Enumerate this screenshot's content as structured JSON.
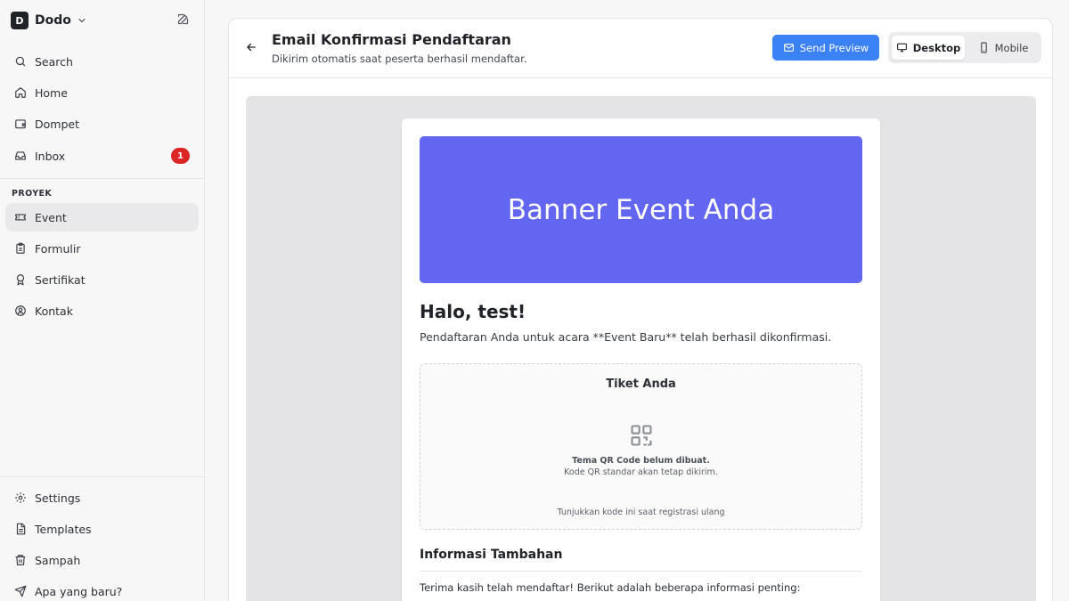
{
  "workspace": {
    "initial": "D",
    "name": "Dodo"
  },
  "sidebar": {
    "top_items": [
      {
        "label": "Search",
        "icon": "search-icon"
      },
      {
        "label": "Home",
        "icon": "home-icon"
      },
      {
        "label": "Dompet",
        "icon": "wallet-icon"
      },
      {
        "label": "Inbox",
        "icon": "inbox-icon",
        "badge": "1"
      }
    ],
    "section_label": "PROYEK",
    "project_items": [
      {
        "label": "Event",
        "icon": "ticket-icon",
        "active": true
      },
      {
        "label": "Formulir",
        "icon": "clipboard-icon"
      },
      {
        "label": "Sertifikat",
        "icon": "award-icon"
      },
      {
        "label": "Kontak",
        "icon": "user-circle-icon"
      }
    ],
    "bottom_items": [
      {
        "label": "Settings",
        "icon": "gear-icon"
      },
      {
        "label": "Templates",
        "icon": "file-icon"
      },
      {
        "label": "Sampah",
        "icon": "trash-icon"
      },
      {
        "label": "Apa yang baru?",
        "icon": "send-icon"
      }
    ]
  },
  "header": {
    "title": "Email Konfirmasi Pendaftaran",
    "subtitle": "Dikirim otomatis saat peserta berhasil mendaftar.",
    "send_label": "Send Preview",
    "view_desktop": "Desktop",
    "view_mobile": "Mobile",
    "active_view": "Desktop"
  },
  "email": {
    "banner_text": "Banner Event Anda",
    "greeting": "Halo, test!",
    "intro": "Pendaftaran Anda untuk acara **Event Baru** telah berhasil dikonfirmasi.",
    "ticket_title": "Tiket Anda",
    "qr_notice_bold": "Tema QR Code belum dibuat.",
    "qr_notice": "Kode QR standar akan tetap dikirim.",
    "ticket_footer": "Tunjukkan kode ini saat registrasi ulang",
    "info_title": "Informasi Tambahan",
    "info_text": "Terima kasih telah mendaftar! Berikut adalah beberapa informasi penting:"
  },
  "colors": {
    "accent": "#3b82f6",
    "banner": "#6366f1",
    "badge": "#dc2626",
    "sidebar_bg": "#f7f7f8",
    "preview_bg": "#e4e4e7"
  }
}
